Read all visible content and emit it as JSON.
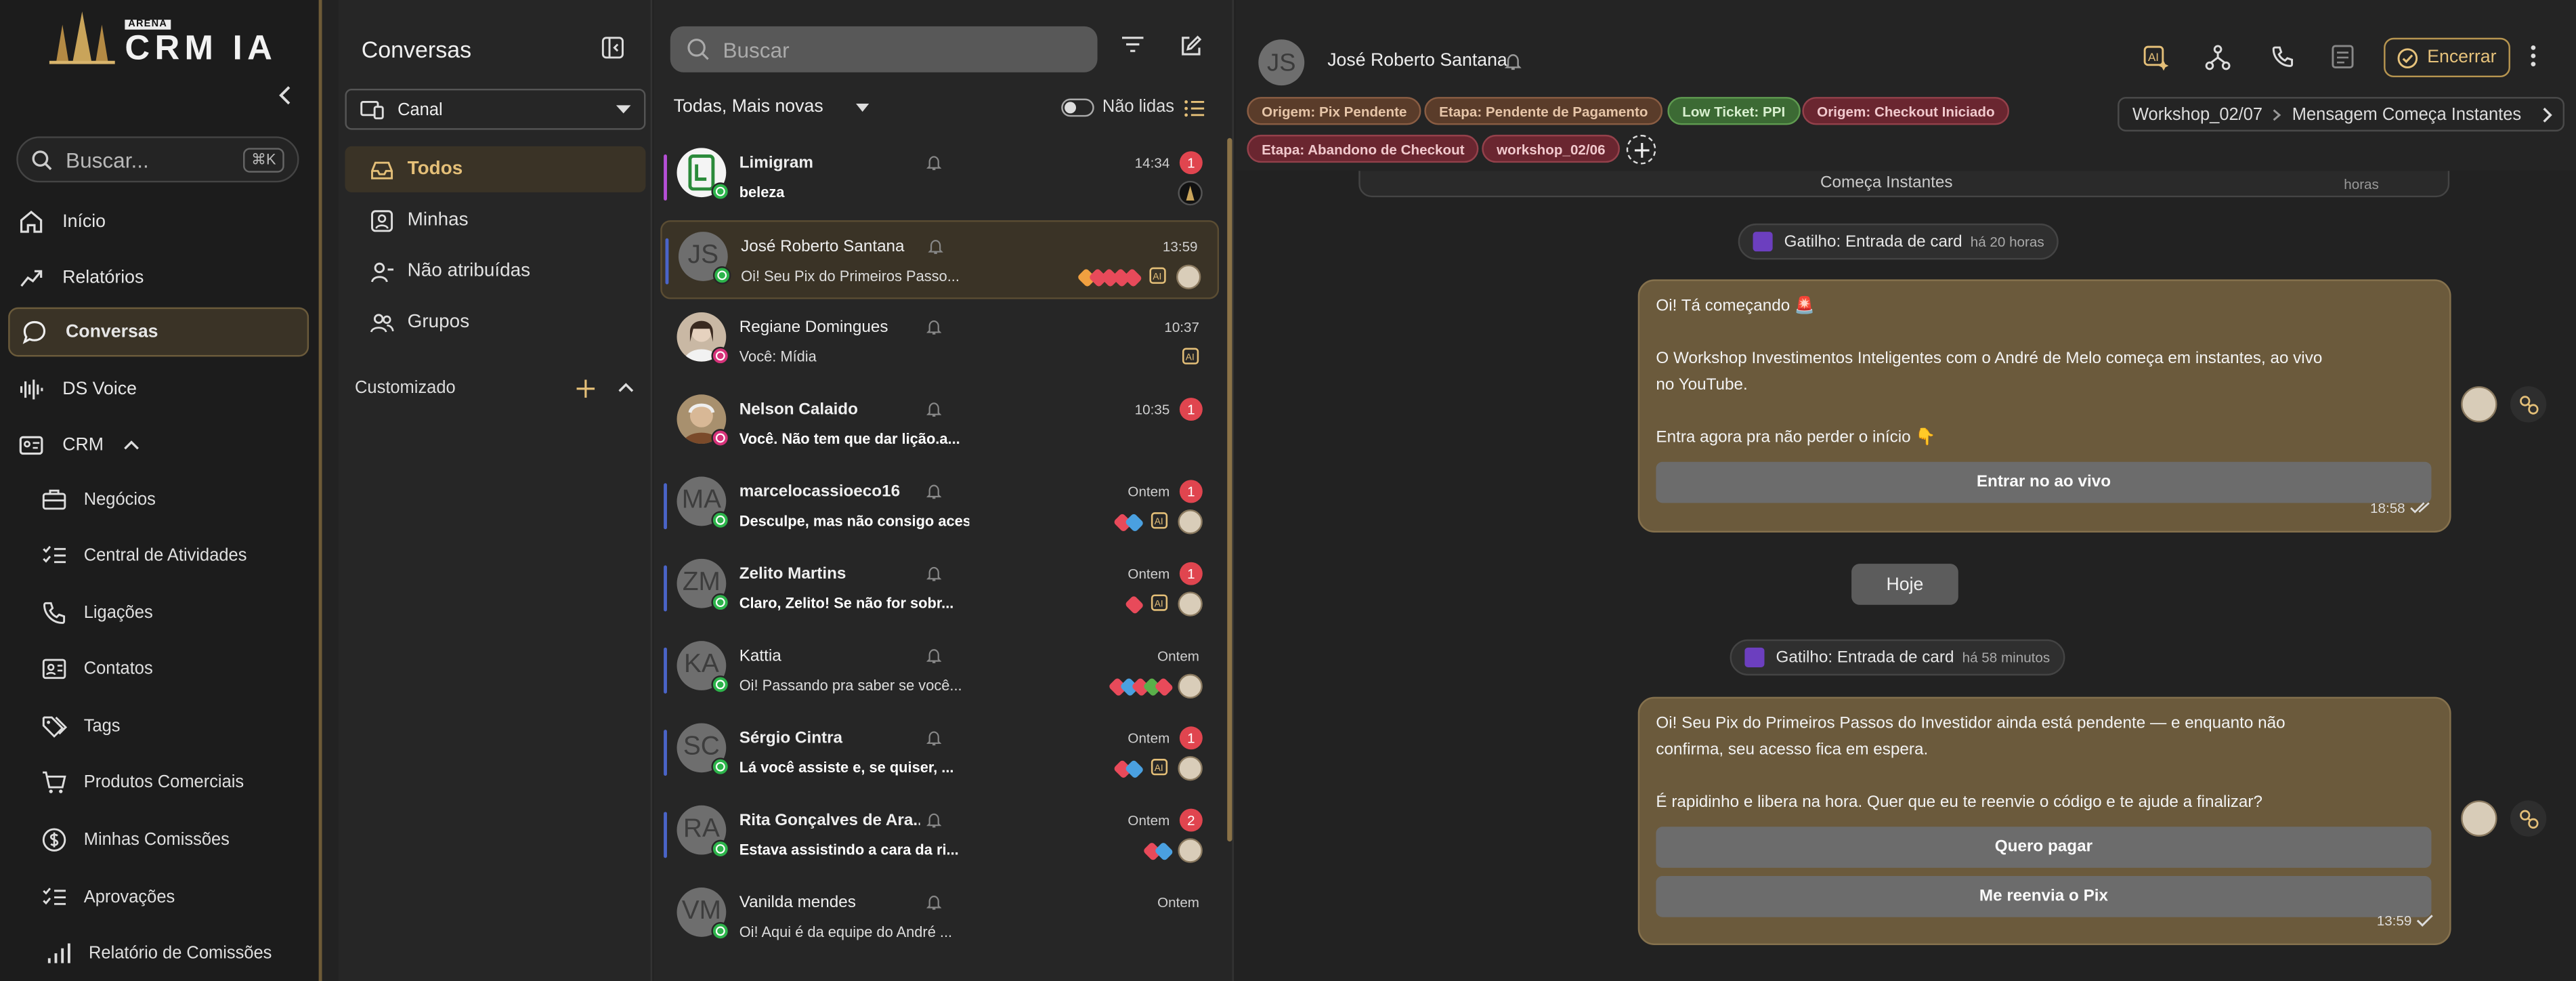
{
  "brand": {
    "small": "ARENA",
    "name": "CRM IA"
  },
  "nav": {
    "search_label": "Buscar...",
    "search_kbd": "⌘K",
    "items": [
      {
        "label": "Início",
        "icon": "home-icon"
      },
      {
        "label": "Relatórios",
        "icon": "chart-icon"
      },
      {
        "label": "Conversas",
        "icon": "chat-icon"
      },
      {
        "label": "DS Voice",
        "icon": "waveform-icon"
      },
      {
        "label": "CRM",
        "icon": "id-card-icon"
      }
    ],
    "sub": [
      {
        "label": "Negócios"
      },
      {
        "label": "Central de Atividades"
      },
      {
        "label": "Ligações"
      },
      {
        "label": "Contatos"
      },
      {
        "label": "Tags"
      },
      {
        "label": "Produtos Comerciais"
      },
      {
        "label": "Minhas Comissões"
      },
      {
        "label": "Aprovações"
      },
      {
        "label": "Relatório de Comissões"
      }
    ]
  },
  "folders": {
    "title": "Conversas",
    "canal": "Canal",
    "items": [
      {
        "label": "Todos"
      },
      {
        "label": "Minhas"
      },
      {
        "label": "Não atribuídas"
      },
      {
        "label": "Grupos"
      }
    ],
    "custom": "Customizado"
  },
  "list": {
    "search_placeholder": "Buscar",
    "sort": "Todas, Mais novas",
    "unread_label": "Não lidas",
    "rows": [
      {
        "initials": "",
        "name": "Limigram",
        "preview": "beleza",
        "time": "14:34",
        "count": "1",
        "bar": "#b54fd6",
        "channel": "wa"
      },
      {
        "initials": "JS",
        "name": "José Roberto Santana",
        "preview": "Oi! Seu Pix do Primeiros Passo...",
        "time": "13:59",
        "count": "",
        "bar": "#4a64c8",
        "channel": "wa"
      },
      {
        "initials": "",
        "name": "Regiane Domingues",
        "preview": "Você: Mídia",
        "time": "10:37",
        "count": "",
        "bar": "",
        "channel": "ig"
      },
      {
        "initials": "",
        "name": "Nelson Calaido",
        "preview": "Você. Não tem que dar lição.a...",
        "time": "10:35",
        "count": "1",
        "bar": "",
        "channel": "ig"
      },
      {
        "initials": "MA",
        "name": "marcelocassioeco16",
        "preview": "Desculpe, mas não consigo aces...",
        "time": "Ontem",
        "count": "1",
        "bar": "#4a64c8",
        "channel": "wa"
      },
      {
        "initials": "ZM",
        "name": "Zelito Martins",
        "preview": "Claro, Zelito! Se não for sobr...",
        "time": "Ontem",
        "count": "1",
        "bar": "#4a64c8",
        "channel": "wa"
      },
      {
        "initials": "KA",
        "name": "Kattia",
        "preview": "Oi! Passando pra saber se você...",
        "time": "Ontem",
        "count": "",
        "bar": "#4a64c8",
        "channel": "wa"
      },
      {
        "initials": "SC",
        "name": "Sérgio Cintra",
        "preview": "Lá você assiste e, se quiser, ...",
        "time": "Ontem",
        "count": "1",
        "bar": "#4a64c8",
        "channel": "wa"
      },
      {
        "initials": "RA",
        "name": "Rita Gonçalves de Ara...",
        "preview": "Estava assistindo a cara da ri...",
        "time": "Ontem",
        "count": "2",
        "bar": "#4a64c8",
        "channel": "wa"
      },
      {
        "initials": "VM",
        "name": "Vanilda mendes",
        "preview": "Oi! Aqui é da equipe do André ...",
        "time": "Ontem",
        "count": "",
        "bar": "",
        "channel": "wa"
      }
    ]
  },
  "chat": {
    "initials": "JS",
    "name": "José Roberto Santana",
    "end_label": "Encerrar",
    "tags": [
      {
        "label": "Origem: Pix Pendente",
        "style": "brown"
      },
      {
        "label": "Etapa: Pendente de Pagamento",
        "style": "brown"
      },
      {
        "label": "Low Ticket: PPI",
        "style": "green"
      },
      {
        "label": "Origem: Checkout Iniciado",
        "style": "red"
      },
      {
        "label": "Etapa: Abandono de Checkout",
        "style": "red"
      },
      {
        "label": "workshop_02/06",
        "style": "red"
      }
    ],
    "crumb": {
      "a": "Workshop_02/07",
      "b": "Mensagem Começa Instantes"
    },
    "prev_bubble": {
      "text": "Começa Instantes",
      "hint": "horas"
    },
    "trigger1": {
      "label": "Gatilho: Entrada de card",
      "ago": "há 20 horas"
    },
    "msg1": {
      "l1": "Oi! Tá começando 🚨",
      "l2": "O Workshop Investimentos Inteligentes com o André de Melo começa em instantes, ao vivo",
      "l3": "no YouTube.",
      "l4": "Entra agora pra não perder o início 👇",
      "btn": "Entrar no ao vivo",
      "time": "18:58"
    },
    "today": "Hoje",
    "trigger2": {
      "label": "Gatilho: Entrada de card",
      "ago": "há 58 minutos"
    },
    "msg2": {
      "l1": "Oi! Seu Pix do Primeiros Passos do Investidor ainda está pendente — e enquanto não",
      "l2": "confirma, seu acesso fica em espera.",
      "l3": "É rapidinho e libera na hora. Quer que eu te reenvie o código e te ajude a finalizar?",
      "btn1": "Quero pagar",
      "btn2": "Me reenvia o Pix",
      "time": "13:59"
    }
  },
  "colors": {
    "accent": "#e4bf78",
    "active_bg": "#3a3326",
    "bubble": "#6b5a3c",
    "unread": "#e0454f"
  }
}
